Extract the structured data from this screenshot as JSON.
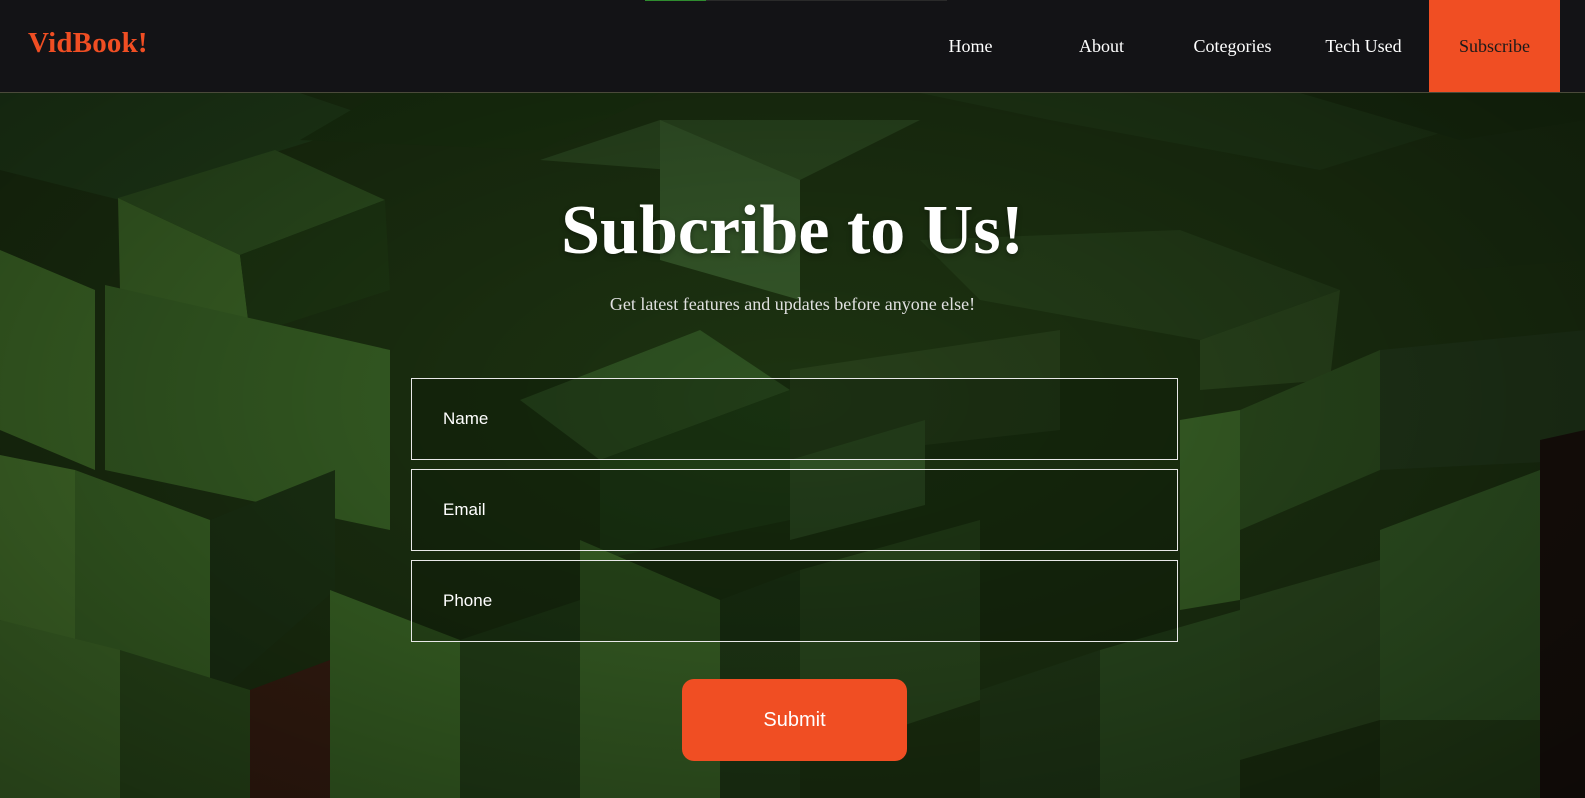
{
  "brand": {
    "logo": "VidBook!",
    "accent_color": "#f04e23"
  },
  "nav": {
    "items": [
      {
        "label": "Home"
      },
      {
        "label": "About"
      },
      {
        "label": "Cotegories"
      },
      {
        "label": "Tech Used"
      },
      {
        "label": "Subscribe",
        "active": true
      }
    ]
  },
  "hero": {
    "title": "Subcribe to Us!",
    "subtitle": "Get latest features and updates before anyone else!"
  },
  "form": {
    "name_placeholder": "Name",
    "email_placeholder": "Email",
    "phone_placeholder": "Phone",
    "submit_label": "Submit"
  },
  "background": {
    "theme": "green-cubes",
    "primary_color": "#2d5a1b"
  }
}
